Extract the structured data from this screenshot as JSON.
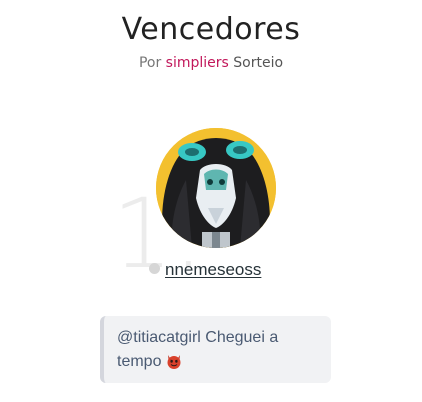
{
  "page": {
    "title": "Vencedores",
    "byline_prefix": "Por",
    "byline_brand": "simpliers",
    "byline_suffix": "Sorteio"
  },
  "winner": {
    "rank": "1.",
    "username": "nnemeseoss",
    "comment_text": "@titiacatgirl Cheguei a tempo",
    "comment_emoji": "devil-face-icon"
  },
  "colors": {
    "brand": "#c2185b",
    "avatar_background": "#f3c02f",
    "comment_background": "#f1f2f4"
  }
}
